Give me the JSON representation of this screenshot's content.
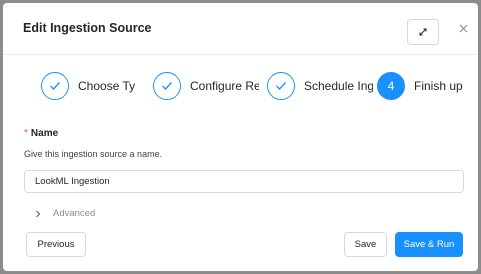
{
  "modal": {
    "title": "Edit Ingestion Source"
  },
  "icons": {
    "expand": "expand-icon",
    "close": "close-icon",
    "check": "check-icon",
    "chevron": "chevron-right-icon"
  },
  "steps": [
    {
      "label": "Choose Type",
      "status": "finished"
    },
    {
      "label": "Configure Recipe",
      "status": "finished"
    },
    {
      "label": "Schedule Ingestion",
      "status": "finished"
    },
    {
      "number": "4",
      "label": "Finish up",
      "status": "active"
    }
  ],
  "form": {
    "name_required_mark": "*",
    "name_label": "Name",
    "name_help": "Give this ingestion source a name.",
    "name_value": "LookML Ingestion",
    "advanced_label": "Advanced"
  },
  "buttons": {
    "previous": "Previous",
    "save": "Save",
    "save_run": "Save & Run"
  },
  "colors": {
    "primary": "#1890ff",
    "required": "#ff4d4f"
  }
}
